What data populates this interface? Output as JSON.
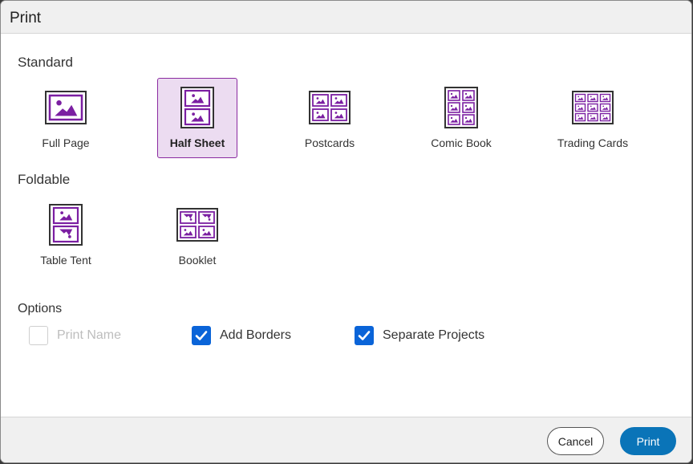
{
  "dialog": {
    "title": "Print"
  },
  "standard": {
    "heading": "Standard",
    "layouts": [
      {
        "label": "Full Page",
        "icon": "full-page-icon",
        "selected": false
      },
      {
        "label": "Half Sheet",
        "icon": "half-sheet-icon",
        "selected": true
      },
      {
        "label": "Postcards",
        "icon": "postcards-icon",
        "selected": false
      },
      {
        "label": "Comic Book",
        "icon": "comic-book-icon",
        "selected": false
      },
      {
        "label": "Trading Cards",
        "icon": "trading-cards-icon",
        "selected": false
      }
    ]
  },
  "foldable": {
    "heading": "Foldable",
    "layouts": [
      {
        "label": "Table Tent",
        "icon": "table-tent-icon",
        "selected": false
      },
      {
        "label": "Booklet",
        "icon": "booklet-icon",
        "selected": false
      }
    ]
  },
  "options": {
    "heading": "Options",
    "items": [
      {
        "label": "Print Name",
        "checked": false,
        "disabled": true
      },
      {
        "label": "Add Borders",
        "checked": true,
        "disabled": false
      },
      {
        "label": "Separate Projects",
        "checked": true,
        "disabled": false
      }
    ]
  },
  "footer": {
    "cancel_label": "Cancel",
    "print_label": "Print"
  },
  "colors": {
    "accent_purple": "#7b1fa2",
    "selected_bg": "#ecdcf1",
    "checkbox_blue": "#0a64d8",
    "print_button": "#0a74b8"
  }
}
